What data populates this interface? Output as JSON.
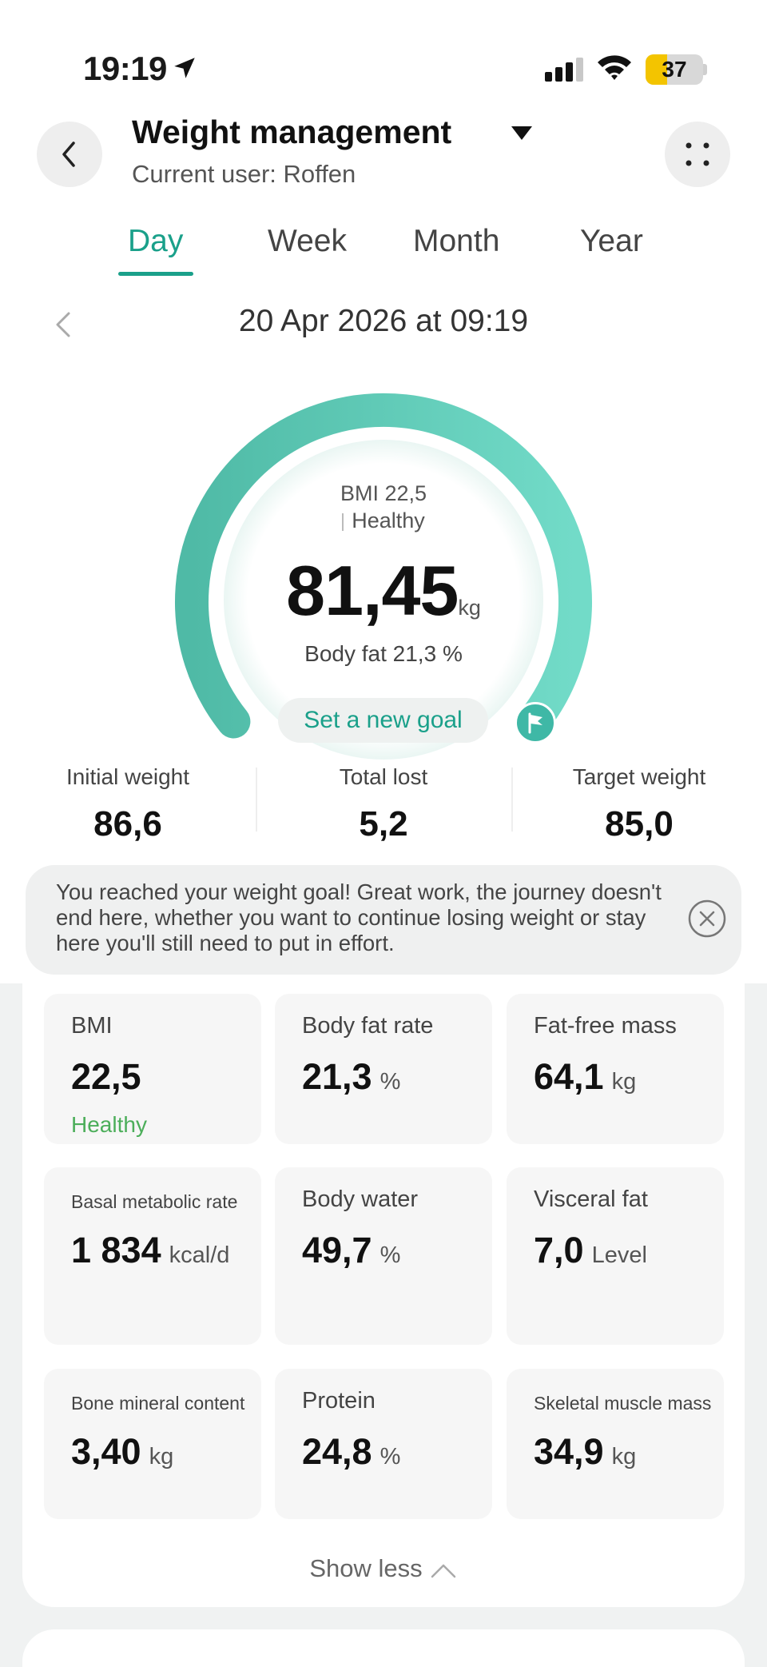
{
  "status_bar": {
    "time": "19:19",
    "battery": "37"
  },
  "header": {
    "title": "Weight management",
    "subtitle": "Current user: Roffen"
  },
  "tabs": [
    {
      "label": "Day",
      "active": true
    },
    {
      "label": "Week",
      "active": false
    },
    {
      "label": "Month",
      "active": false
    },
    {
      "label": "Year",
      "active": false
    }
  ],
  "datetime": "20 Apr 2026 at 09:19",
  "gauge": {
    "bmi": "BMI 22,5",
    "status": "Healthy",
    "weight": "81,45",
    "weight_unit": "kg",
    "body_fat": "Body fat 21,3 %",
    "goal_button": "Set a new goal"
  },
  "stats": [
    {
      "label": "Initial weight",
      "value": "86,6"
    },
    {
      "label": "Total lost",
      "value": "5,2"
    },
    {
      "label": "Target weight",
      "value": "85,0"
    }
  ],
  "notice": "You reached your weight goal! Great work, the journey doesn't end here, whether you want to continue losing weight or stay here you'll still need to put in effort.",
  "metrics": [
    {
      "label": "BMI",
      "value": "22,5",
      "unit": "",
      "status": "Healthy"
    },
    {
      "label": "Body fat rate",
      "value": "21,3",
      "unit": "%"
    },
    {
      "label": "Fat-free mass",
      "value": "64,1",
      "unit": "kg"
    },
    {
      "label": "Basal metabolic rate",
      "value": "1 834",
      "unit": "kcal/d"
    },
    {
      "label": "Body water",
      "value": "49,7",
      "unit": "%"
    },
    {
      "label": "Visceral fat",
      "value": "7,0",
      "unit": "Level"
    },
    {
      "label": "Bone mineral content",
      "value": "3,40",
      "unit": "kg"
    },
    {
      "label": "Protein",
      "value": "24,8",
      "unit": "%"
    },
    {
      "label": "Skeletal muscle mass",
      "value": "34,9",
      "unit": "kg"
    }
  ],
  "show_less": "Show less",
  "colors": {
    "accent": "#1aa08a",
    "healthy": "#4cae5a",
    "battery": "#f3c400"
  }
}
